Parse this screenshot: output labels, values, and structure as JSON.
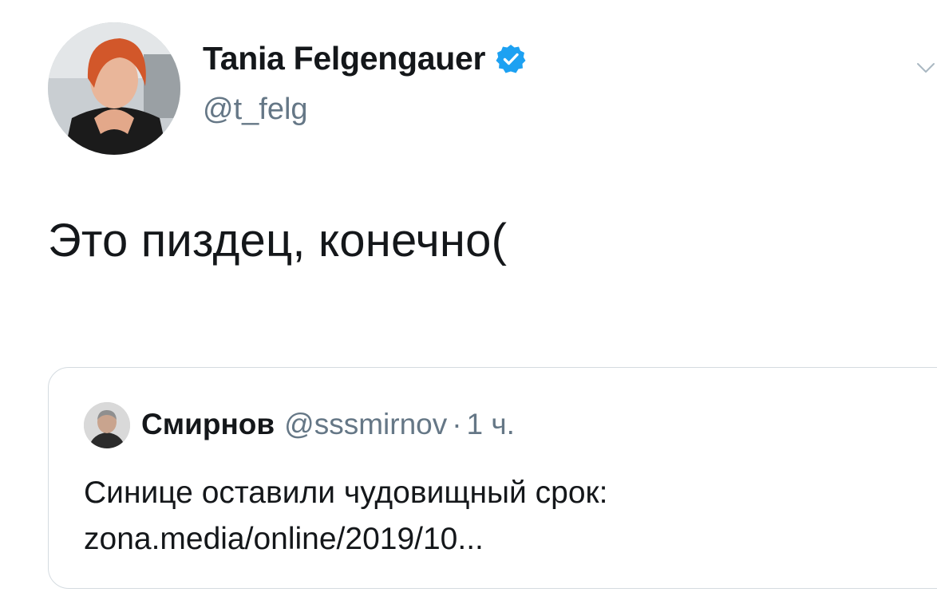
{
  "tweet": {
    "author": {
      "display_name": "Tania Felgengauer",
      "handle": "@t_felg",
      "verified": true
    },
    "text": "Это пиздец, конечно(",
    "menu_icon": "chevron-down-icon"
  },
  "quote": {
    "author": {
      "display_name": "Смирнов",
      "handle": "@sssmirnov",
      "separator": "·",
      "time": "1 ч."
    },
    "text_line1": "Синице оставили чудовищный срок:",
    "text_line2": "zona.media/online/2019/10..."
  },
  "colors": {
    "primary_text": "#14171a",
    "secondary_text": "#657786",
    "verified_blue": "#1da1f2",
    "card_border": "#d4dbe0"
  }
}
